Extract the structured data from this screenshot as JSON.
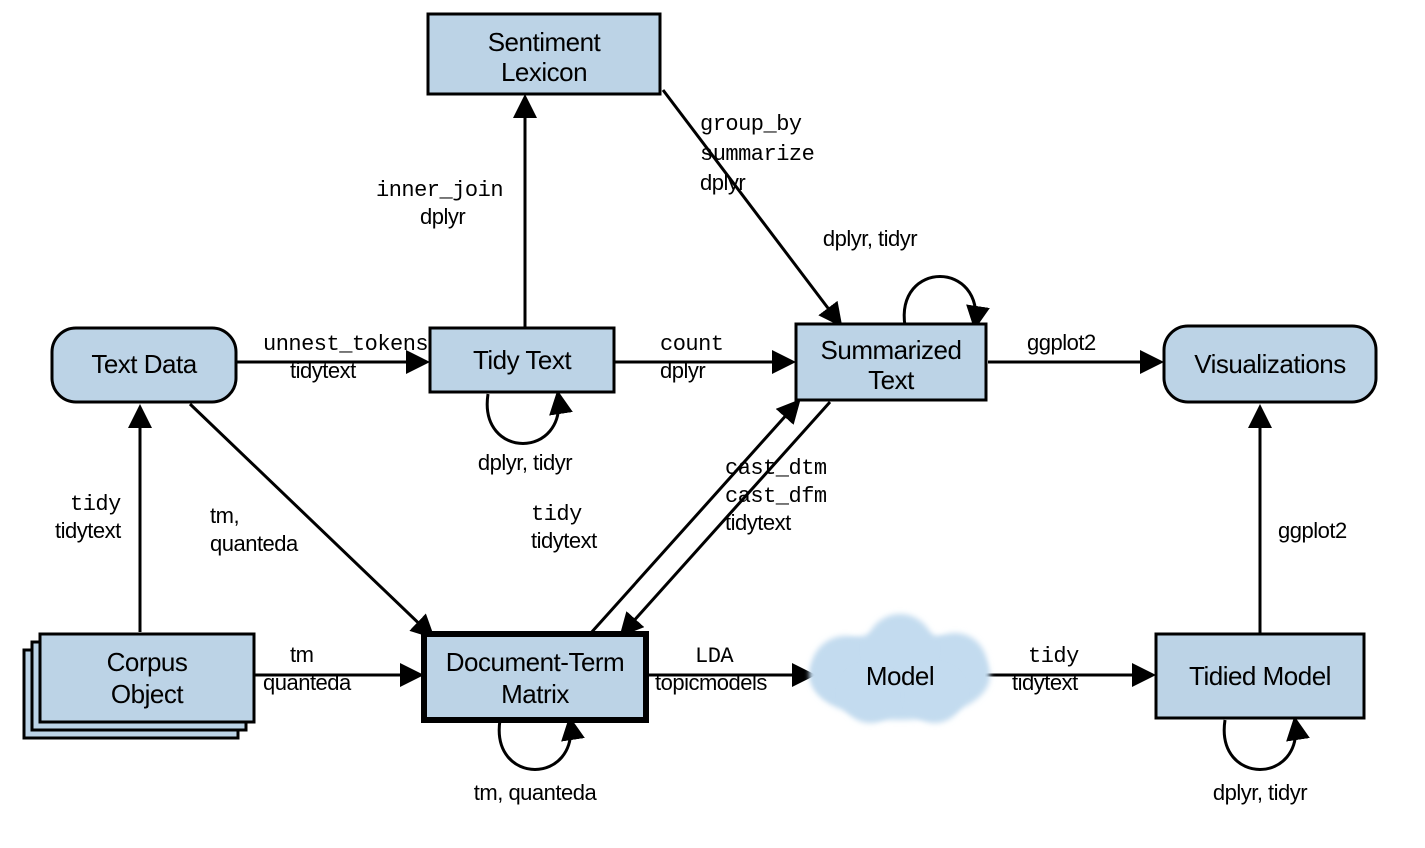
{
  "nodes": {
    "text_data": "Text Data",
    "tidy_text": "Tidy Text",
    "sentiment_lexicon_l1": "Sentiment",
    "sentiment_lexicon_l2": "Lexicon",
    "summarized_text_l1": "Summarized",
    "summarized_text_l2": "Text",
    "visualizations": "Visualizations",
    "corpus_object_l1": "Corpus",
    "corpus_object_l2": "Object",
    "dtm_l1": "Document-Term",
    "dtm_l2": "Matrix",
    "model": "Model",
    "tidied_model": "Tidied Model"
  },
  "edges": {
    "unnest_tokens_fn": "unnest_tokens",
    "unnest_tokens_pkg": "tidytext",
    "inner_join_fn": "inner_join",
    "inner_join_pkg": "dplyr",
    "group_by_l1": "group_by",
    "group_by_l2": "summarize",
    "group_by_pkg": "dplyr",
    "count_fn": "count",
    "count_pkg": "dplyr",
    "summ_loop": "dplyr, tidyr",
    "ggplot2_top": "ggplot2",
    "tidytext_loop": "dplyr, tidyr",
    "tidy_fn": "tidy",
    "tidy_pkg": "tidytext",
    "tm_fn": "tm,",
    "tm_pkg": "quanteda",
    "corpus_dtm_l1": "tm",
    "corpus_dtm_l2": "quanteda",
    "dtm_tidy_fn": "tidy",
    "dtm_tidy_pkg": "tidytext",
    "cast_l1": "cast_dtm",
    "cast_l2": "cast_dfm",
    "cast_pkg": "tidytext",
    "dtm_loop": "tm, quanteda",
    "lda_fn": "LDA",
    "lda_pkg": "topicmodels",
    "model_tidy_fn": "tidy",
    "model_tidy_pkg": "tidytext",
    "ggplot2_right": "ggplot2",
    "tidied_loop": "dplyr, tidyr"
  }
}
